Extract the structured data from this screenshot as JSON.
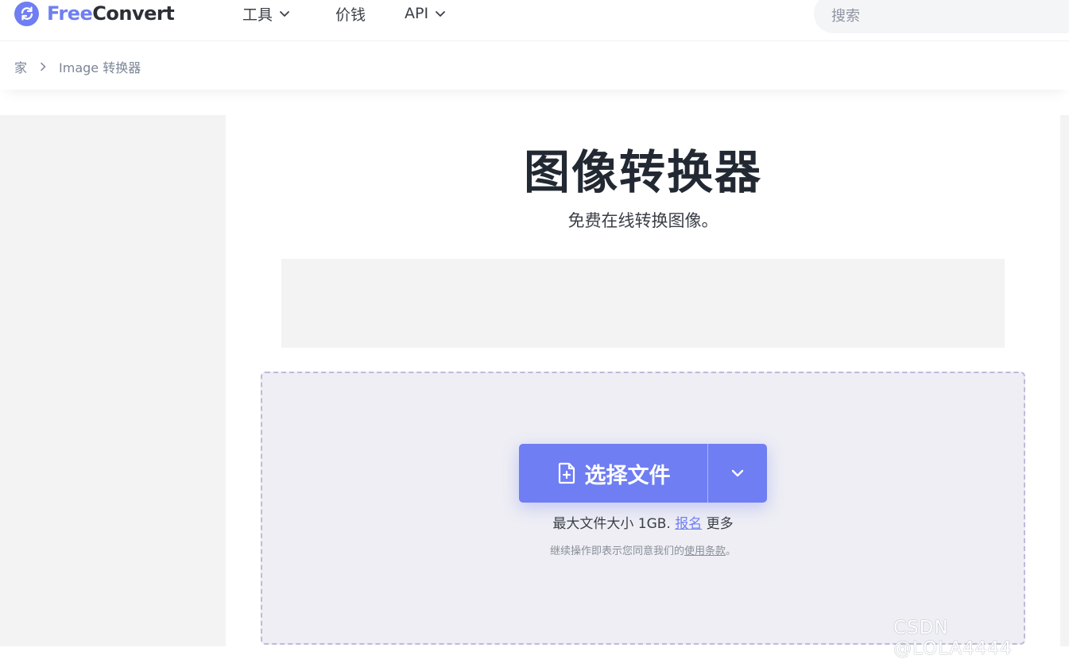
{
  "header": {
    "logo_free": "Free",
    "logo_convert": "Convert",
    "nav": {
      "tools": "工具",
      "pricing": "价钱",
      "api": "API"
    },
    "search_placeholder": "搜索"
  },
  "breadcrumb": {
    "home": "家",
    "current": "Image 转换器"
  },
  "main": {
    "title": "图像转换器",
    "subtitle": "免费在线转换图像。",
    "choose_file_label": "选择文件",
    "max_size_text": "最大文件大小 1GB.",
    "signup_link": "报名",
    "more_text": "更多",
    "terms_prefix": "继续操作即表示您同意我们的",
    "terms_link": "使用条款",
    "terms_suffix": "。"
  },
  "watermark": "CSDN @LOLA4444",
  "colors": {
    "brand": "#6f7ef2",
    "dropzone_bg": "#eeeef4",
    "dropzone_border": "#c0b8dc"
  },
  "icons": [
    "refresh-logo-icon",
    "chevron-down-icon",
    "chevron-right-icon",
    "file-plus-icon"
  ]
}
